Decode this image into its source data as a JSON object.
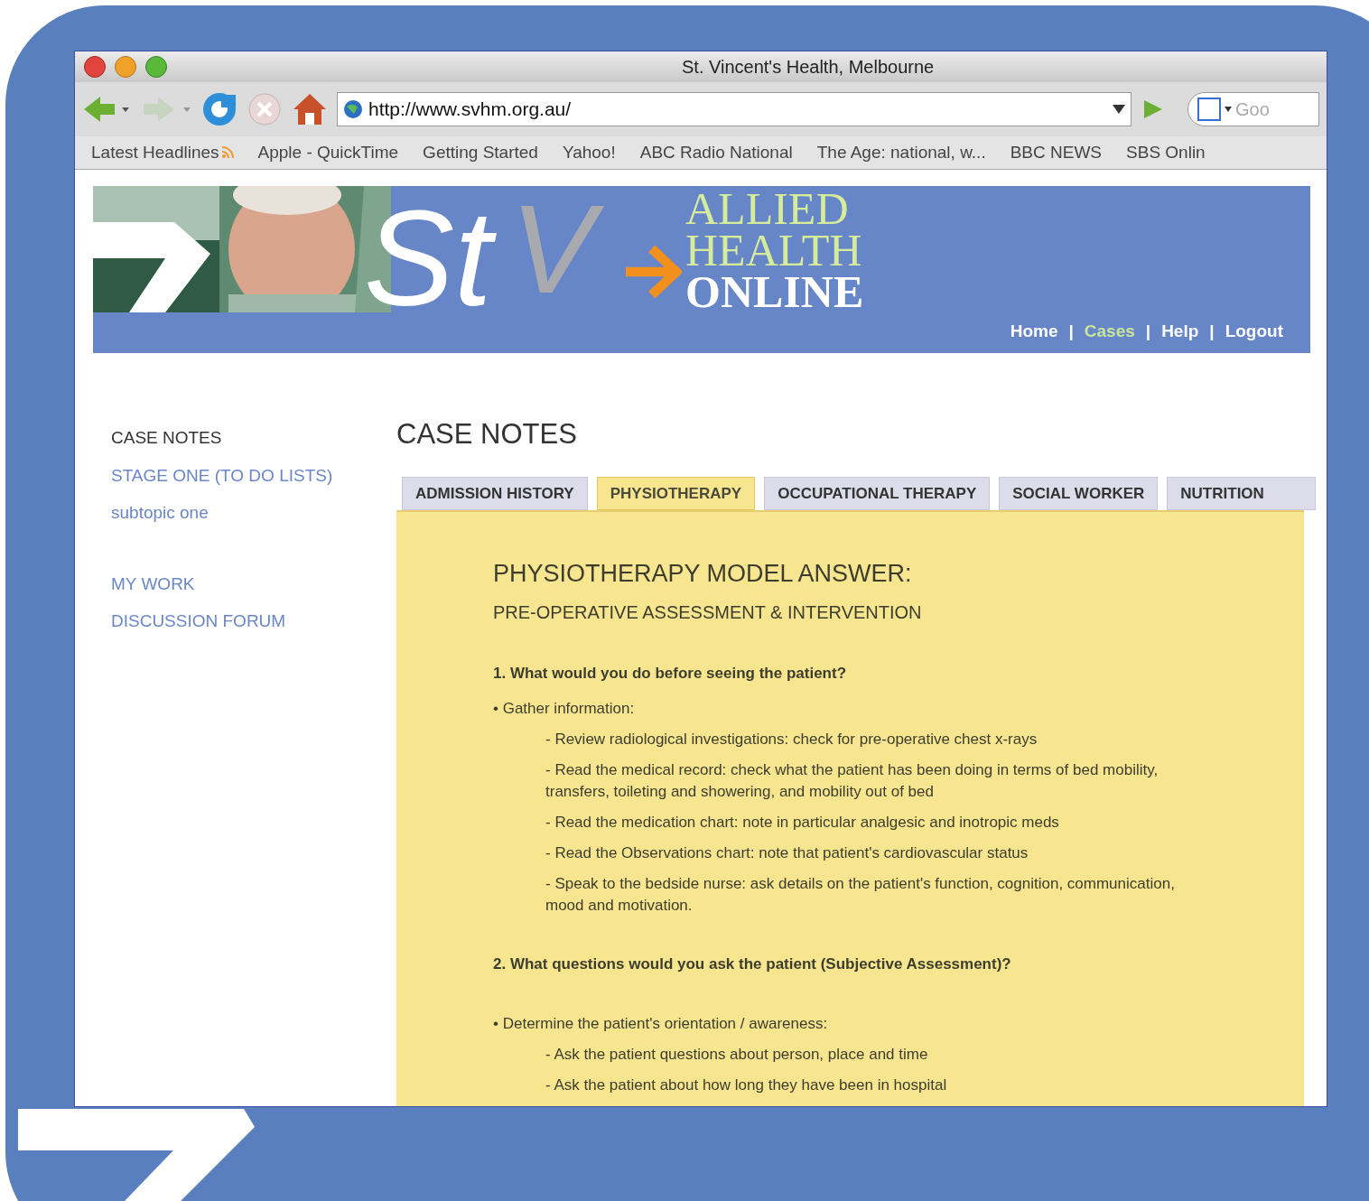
{
  "window": {
    "title": "St. Vincent's Health, Melbourne"
  },
  "toolbar": {
    "url": "http://www.svhm.org.au/",
    "search_placeholder": "Goo"
  },
  "bookmarks": [
    {
      "label": "Latest Headlines",
      "feed": true
    },
    {
      "label": "Apple - QuickTime",
      "feed": false
    },
    {
      "label": "Getting Started",
      "feed": false
    },
    {
      "label": "Yahoo!",
      "feed": false
    },
    {
      "label": "ABC Radio National",
      "feed": false
    },
    {
      "label": "The Age: national, w...",
      "feed": false
    },
    {
      "label": "BBC NEWS",
      "feed": false
    },
    {
      "label": "SBS Onlin",
      "feed": false
    }
  ],
  "banner": {
    "logo_left": "St",
    "logo_right": "V",
    "title_lines": [
      "ALLIED",
      "HEALTH",
      "ONLINE"
    ],
    "nav": [
      {
        "label": "Home",
        "selected": false
      },
      {
        "label": "Cases",
        "selected": true
      },
      {
        "label": "Help",
        "selected": false
      },
      {
        "label": "Logout",
        "selected": false
      }
    ],
    "separator": "|"
  },
  "sidebar": {
    "groups": [
      [
        {
          "label": "CASE NOTES",
          "selected": true
        },
        {
          "label": "STAGE ONE (TO DO LISTS)",
          "selected": false
        },
        {
          "label": "subtopic one",
          "selected": false
        }
      ],
      [
        {
          "label": "MY WORK",
          "selected": false
        },
        {
          "label": "DISCUSSION FORUM",
          "selected": false
        }
      ]
    ]
  },
  "page_title": "CASE NOTES",
  "tabs": [
    {
      "label": "ADMISSION HISTORY",
      "selected": false
    },
    {
      "label": "PHYSIOTHERAPY",
      "selected": true
    },
    {
      "label": "OCCUPATIONAL THERAPY",
      "selected": false
    },
    {
      "label": "SOCIAL WORKER",
      "selected": false
    },
    {
      "label": "NUTRITION",
      "selected": false
    }
  ],
  "content": [
    {
      "kind": "heading",
      "text": "PHYSIOTHERAPY MODEL ANSWER:"
    },
    {
      "kind": "subheading",
      "text": "PRE-OPERATIVE ASSESSMENT & INTERVENTION"
    },
    {
      "kind": "question",
      "text": "1.  What would you do before seeing the patient?"
    },
    {
      "kind": "bullet",
      "text": "• Gather information:"
    },
    {
      "kind": "item",
      "text": "- Review radiological investigations: check for pre-operative chest x-rays"
    },
    {
      "kind": "item",
      "text": "- Read the medical record: check what the patient has been doing in terms of bed mobility, transfers, toileting and showering, and mobility out of bed"
    },
    {
      "kind": "item",
      "text": "- Read the medication chart: note in particular analgesic and inotropic meds"
    },
    {
      "kind": "item",
      "text": "- Read the Observations chart: note that patient's cardiovascular status"
    },
    {
      "kind": "item",
      "text": "- Speak to the bedside nurse: ask details on the patient's function, cognition, communication, mood and motivation."
    },
    {
      "kind": "question",
      "text": "2. What questions would you ask the patient (Subjective Assessment)?"
    },
    {
      "kind": "bullet",
      "text": "• Determine the patient's orientation / awareness:"
    },
    {
      "kind": "item",
      "text": "- Ask the patient questions about person, place and time"
    },
    {
      "kind": "item",
      "text": "- Ask the patient about how long they have been in hospital"
    }
  ]
}
